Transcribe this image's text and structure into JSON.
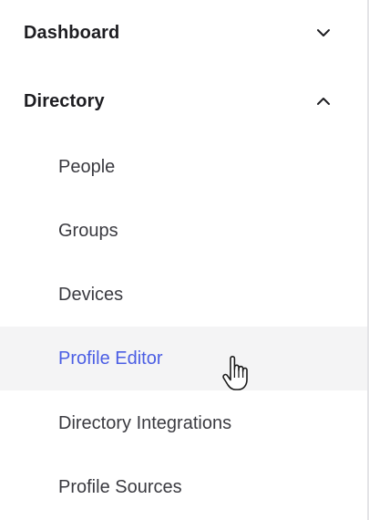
{
  "nav": {
    "sections": [
      {
        "label": "Dashboard",
        "expanded": false,
        "icon": "chevron-down-icon"
      },
      {
        "label": "Directory",
        "expanded": true,
        "icon": "chevron-up-icon"
      }
    ],
    "directory_items": [
      {
        "label": "People"
      },
      {
        "label": "Groups"
      },
      {
        "label": "Devices"
      },
      {
        "label": "Profile Editor",
        "active": true
      },
      {
        "label": "Directory Integrations"
      },
      {
        "label": "Profile Sources"
      }
    ]
  },
  "colors": {
    "text": "#1d1d21",
    "item_text": "#3a3a40",
    "active_text": "#4b5ee4",
    "active_bg": "#f4f4f5"
  },
  "cursor": {
    "icon": "hand-pointer-cursor-icon"
  }
}
